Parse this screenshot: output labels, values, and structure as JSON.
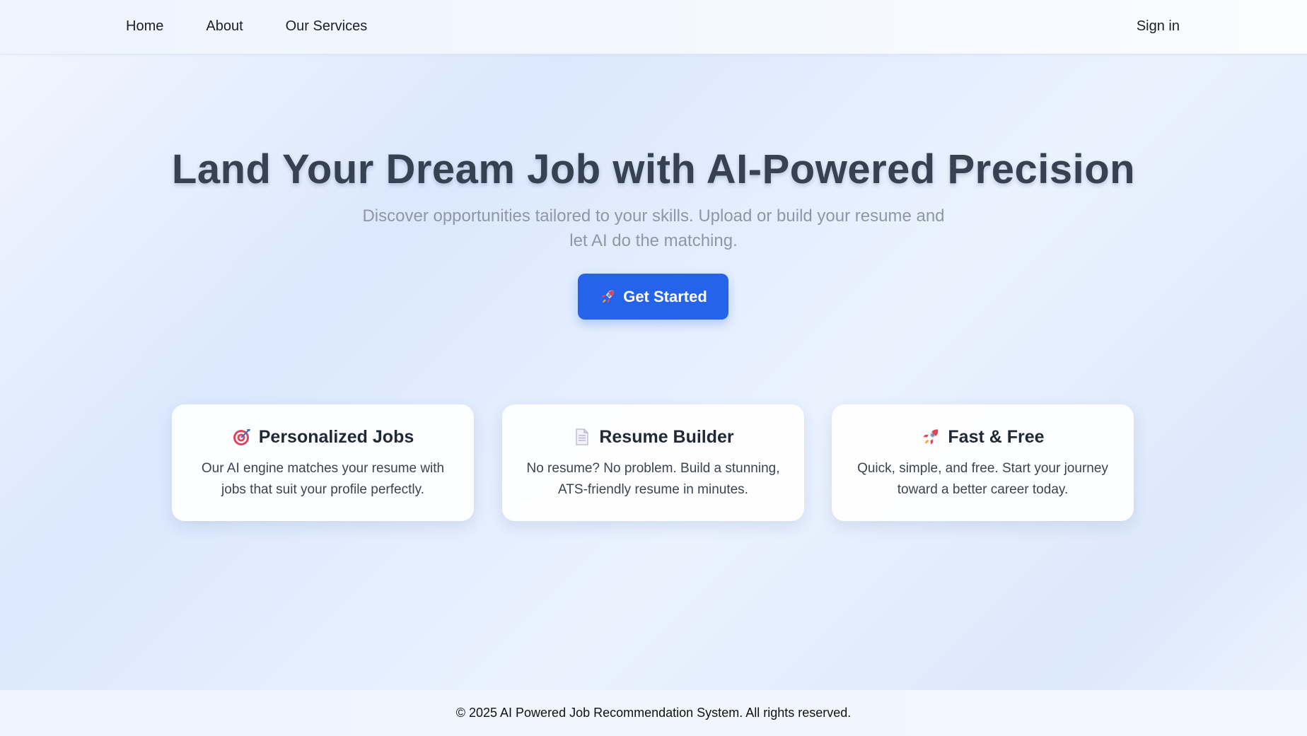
{
  "nav": {
    "links": [
      "Home",
      "About",
      "Our Services"
    ],
    "signin": "Sign in"
  },
  "hero": {
    "title": "Land Your Dream Job with AI-Powered Precision",
    "subtitle": "Discover opportunities tailored to your skills. Upload or build your resume and let AI do the matching.",
    "cta_label": "Get Started",
    "cta_icon": "rocket-icon",
    "cta_color": "#2563eb"
  },
  "features": [
    {
      "icon": "target-icon",
      "title": "Personalized Jobs",
      "desc": "Our AI engine matches your resume with jobs that suit your profile perfectly."
    },
    {
      "icon": "document-icon",
      "title": "Resume Builder",
      "desc": "No resume? No problem. Build a stunning, ATS-friendly resume in minutes."
    },
    {
      "icon": "rocket-icon",
      "title": "Fast & Free",
      "desc": "Quick, simple, and free. Start your journey toward a better career today."
    }
  ],
  "footer": {
    "text": "© 2025 AI Powered Job Recommendation System. All rights reserved."
  }
}
